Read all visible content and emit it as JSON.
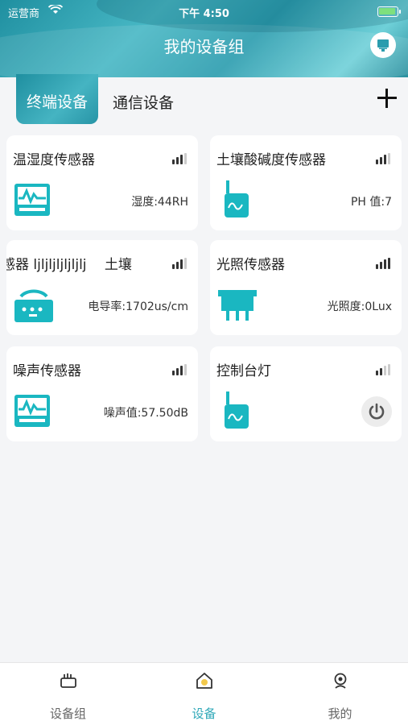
{
  "status_bar": {
    "carrier": "运营商",
    "time": "下午 4:50"
  },
  "header": {
    "title": "我的设备组"
  },
  "tabs": [
    {
      "label": "终端设备",
      "active": true
    },
    {
      "label": "通信设备",
      "active": false
    }
  ],
  "devices": [
    {
      "name": "温湿度传感器",
      "reading": "湿度:44RH",
      "signal_level": 3,
      "icon": "monitor-wave-icon"
    },
    {
      "name": "土壤酸碱度传感器",
      "reading": "PH 值:7",
      "signal_level": 3,
      "icon": "antenna-sensor-icon"
    },
    {
      "name": "感器 ljljljljljljlj　 土壤",
      "reading": "电导率:1702us/cm",
      "signal_level": 3,
      "icon": "router-icon"
    },
    {
      "name": "光照传感器",
      "reading": "光照度:0Lux",
      "signal_level": 4,
      "icon": "light-sensor-icon"
    },
    {
      "name": "噪声传感器",
      "reading": "噪声值:57.50dB",
      "signal_level": 3,
      "icon": "monitor-wave-icon"
    },
    {
      "name": "控制台灯",
      "reading": "",
      "signal_level": 2,
      "icon": "antenna-sensor-icon",
      "has_power_button": true
    }
  ],
  "bottom_nav": [
    {
      "label": "设备组",
      "icon": "device-group-icon",
      "active": false
    },
    {
      "label": "设备",
      "icon": "home-device-icon",
      "active": true
    },
    {
      "label": "我的",
      "icon": "profile-icon",
      "active": false
    }
  ],
  "colors": {
    "accent": "#2fa8b8",
    "icon_teal": "#1ab7c1"
  }
}
